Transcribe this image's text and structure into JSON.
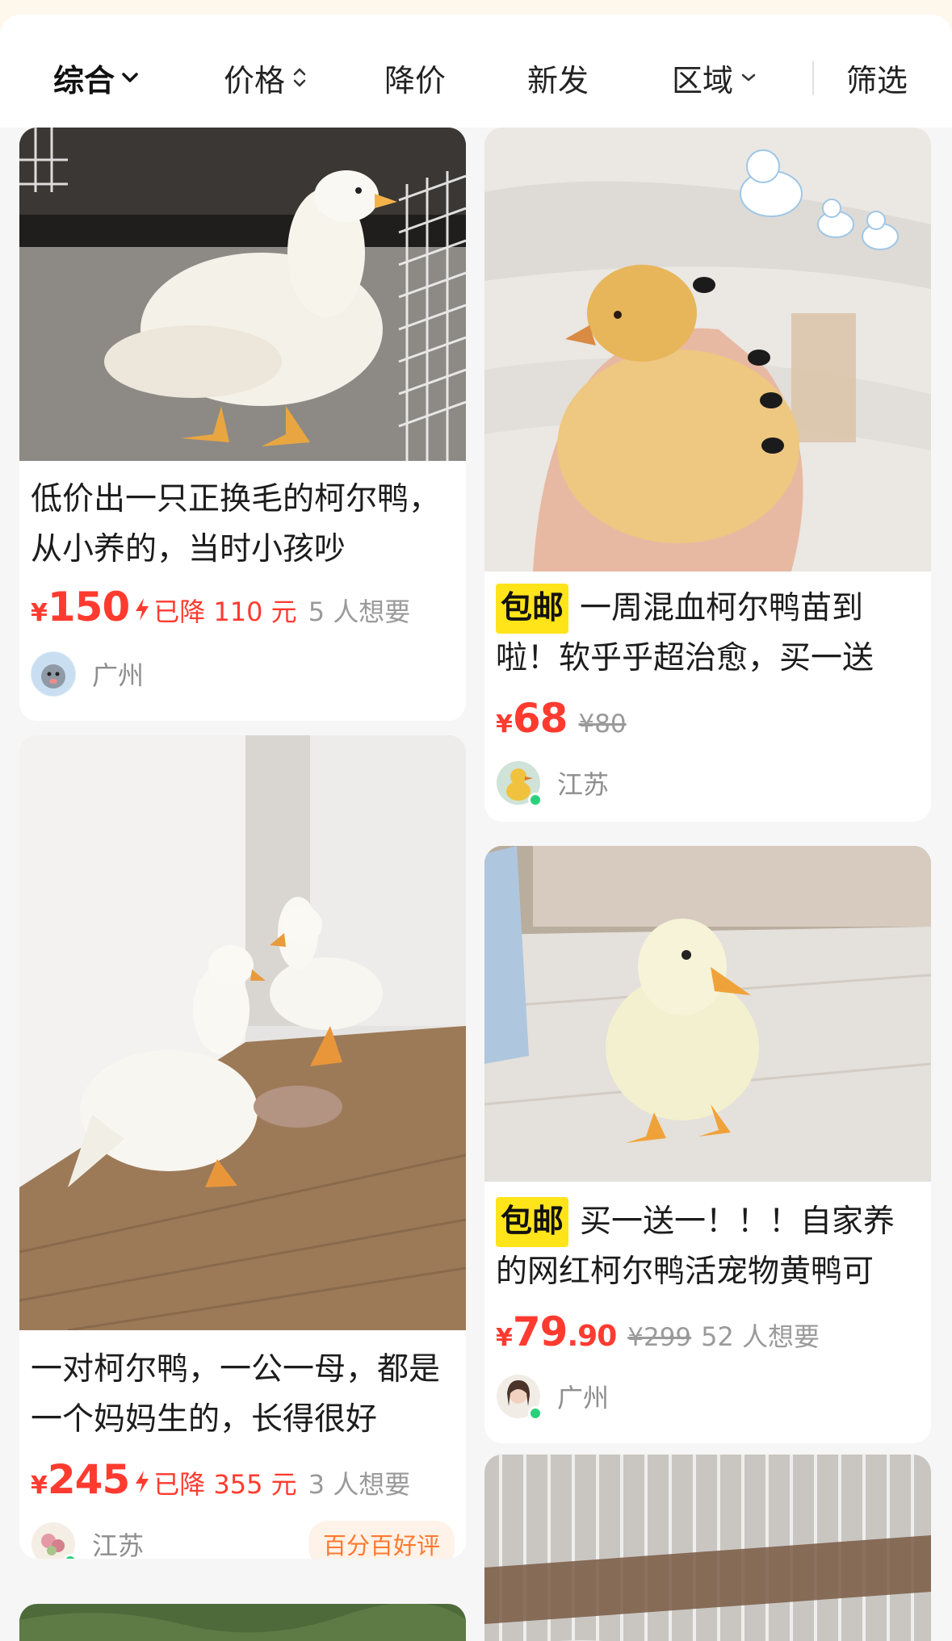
{
  "sort_bar": {
    "items": [
      {
        "label": "综合",
        "active": true
      },
      {
        "label": "价格"
      },
      {
        "label": "降价"
      },
      {
        "label": "新发"
      },
      {
        "label": "区域"
      }
    ],
    "filter_label": "筛选"
  },
  "listings": [
    {
      "title": "低价出一只正换毛的柯尔鸭，从小养的，当时小孩吵",
      "currency": "¥",
      "price": "150",
      "price_drop": "已降 110 元",
      "wants": "5 人想要",
      "region": "广州"
    },
    {
      "badge": "包邮",
      "title": "一周混血柯尔鸭苗到啦！软乎乎超治愈，买一送",
      "currency": "¥",
      "price": "68",
      "original_price": "¥80",
      "region": "江苏"
    },
    {
      "title": "一对柯尔鸭，一公一母，都是一个妈妈生的，长得很好",
      "currency": "¥",
      "price": "245",
      "price_drop": "已降 355 元",
      "wants": "3 人想要",
      "region": "江苏",
      "tag": "百分百好评"
    },
    {
      "badge": "包邮",
      "title": "买一送一！！！自家养的网红柯尔鸭活宠物黄鸭可",
      "currency": "¥",
      "price_int": "79",
      "price_dec": ".90",
      "original_price": "¥299",
      "wants": "52 人想要",
      "region": "广州"
    }
  ],
  "colors": {
    "price_red": "#ff3b30",
    "badge_yellow": "#ffe41a",
    "good_rate_orange": "#ff7a2f",
    "online_green": "#2bd17a"
  }
}
